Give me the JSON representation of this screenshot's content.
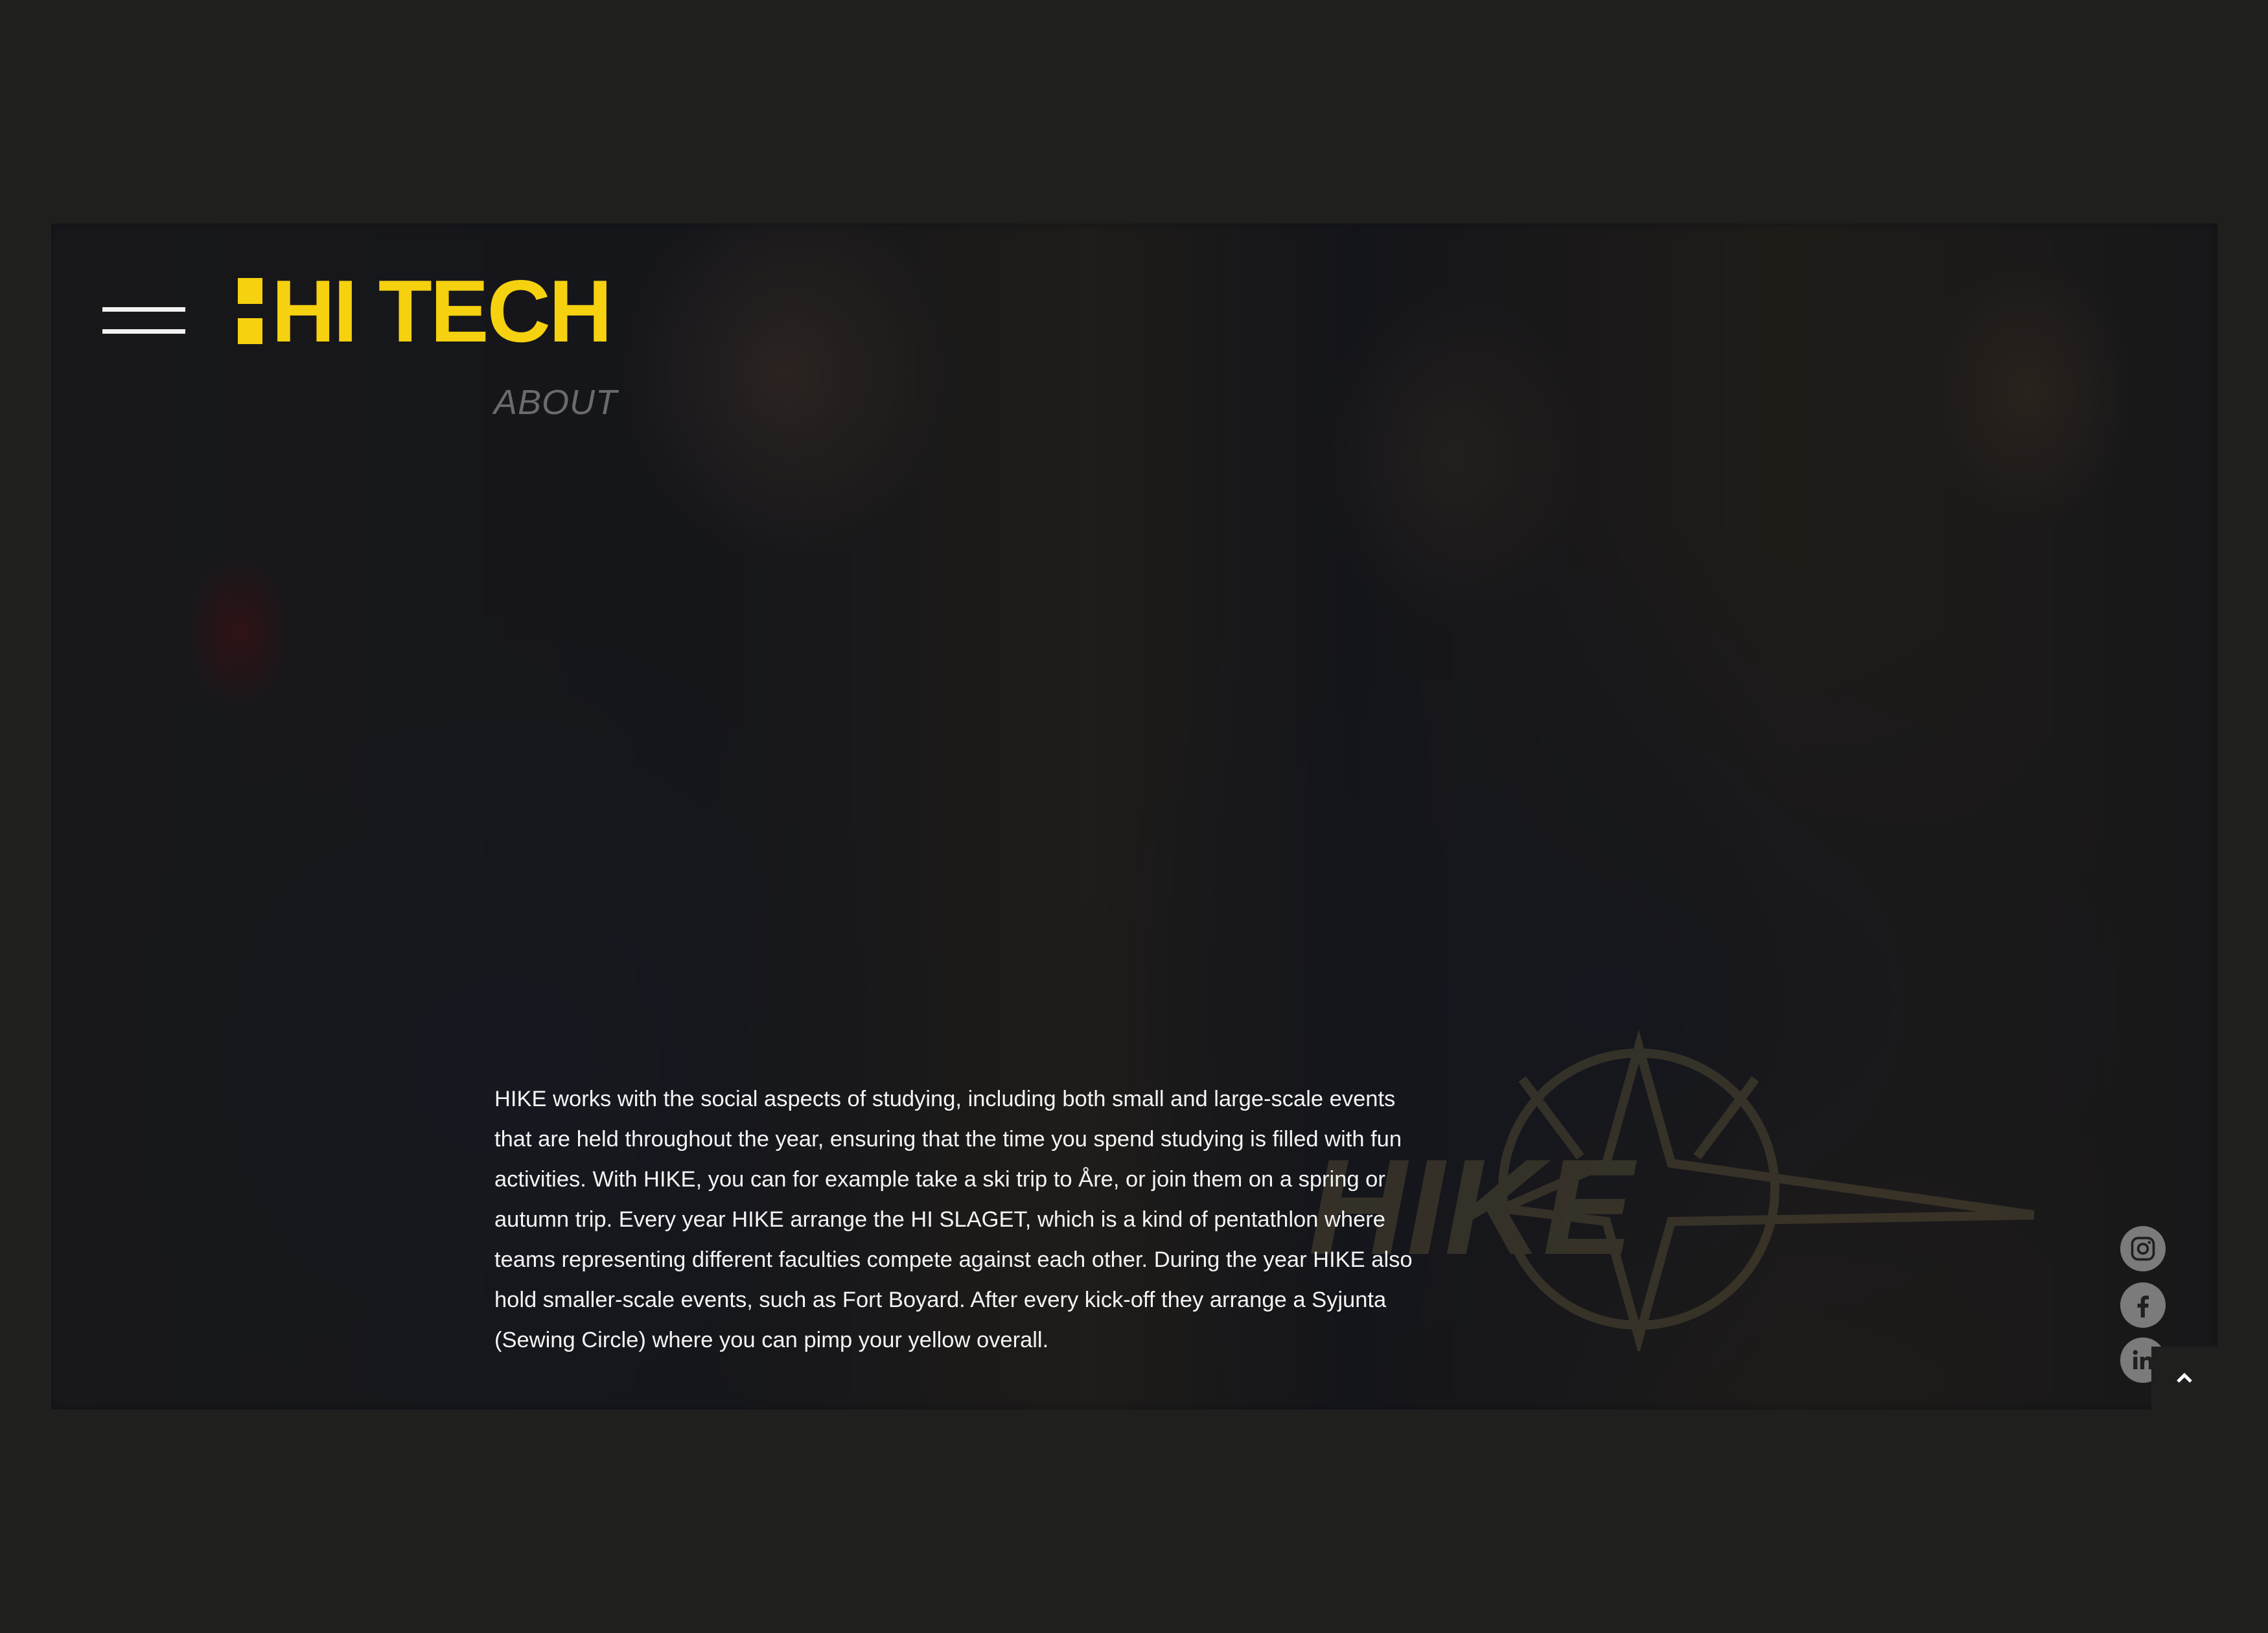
{
  "header": {
    "menu_icon": "hamburger-menu-icon",
    "logo_text": "HI TECH",
    "logo_color": "#f5d10f"
  },
  "section": {
    "title": "ABOUT",
    "description": "HIKE works with the social aspects of studying, including both small and large-scale events that are held throughout the year, ensuring that the time you spend studying is filled with fun activities. With HIKE, you can for example take a ski trip to Åre, or join them on a spring or autumn trip. Every year HIKE arrange the HI SLAGET, which is a kind of pentathlon where teams representing different faculties compete against each other. During the year HIKE also hold smaller-scale events, such as Fort Boyard. After every kick-off they arrange a Syjunta (Sewing Circle) where you can pimp your yellow overall."
  },
  "hero": {
    "watermark_text": "HIKE"
  },
  "social": [
    {
      "icon": "instagram-icon"
    },
    {
      "icon": "facebook-icon"
    },
    {
      "icon": "linkedin-icon"
    }
  ],
  "back_to_top_icon": "chevron-up-icon",
  "colors": {
    "background": "#1f1f1e",
    "text": "#f4f4f4",
    "muted_title": "#6b6b6b",
    "social_icon": "#7b7b7b"
  }
}
